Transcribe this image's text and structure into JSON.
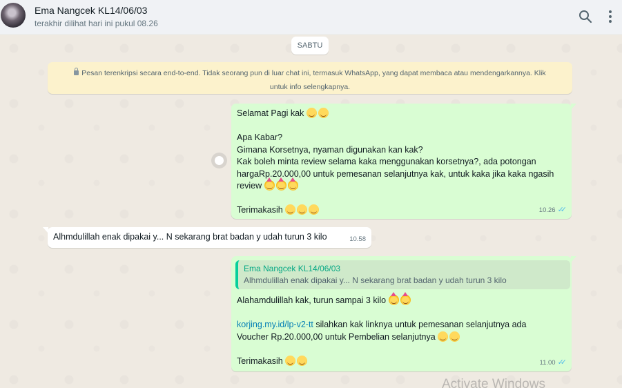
{
  "header": {
    "contact_name": "Ema Nangcek KL14/06/03",
    "last_seen": "terakhir dilihat hari ini pukul 08.26",
    "search_icon": "search-icon",
    "menu_icon": "more-vertical-icon"
  },
  "chat": {
    "date_chip": "SABTU",
    "encryption_notice_line1": "Pesan terenkripsi secara end-to-end. Tidak seorang pun di luar chat ini, termasuk WhatsApp, yang dapat membaca atau mendengarkannya. Klik",
    "encryption_notice_line2": "untuk info selengkapnya.",
    "messages": [
      {
        "direction": "outgoing",
        "line1": "Selamat Pagi kak",
        "line2": "Apa Kabar?",
        "line3": "Gimana Korsetnya, nyaman digunakan kan kak?",
        "line4": "Kak boleh minta review selama kaka menggunakan korsetnya?, ada potongan",
        "line5": "hargaRp.20.000,00 untuk pemesanan selanjutnya kak, untuk kaka jika kaka ngasih",
        "line6": "review",
        "line7": "Terimakasih",
        "time": "10.26",
        "status": "read"
      },
      {
        "direction": "incoming",
        "text": "Alhmdulillah enak dipakai y... N sekarang brat badan y udah turun 3 kilo",
        "time": "10.58"
      },
      {
        "direction": "outgoing",
        "quote_author": "Ema Nangcek KL14/06/03",
        "quote_text": "Alhmdulillah enak dipakai y... N sekarang brat badan y udah turun 3 kilo",
        "line1": "Alahamdulillah kak, turun sampai 3 kilo",
        "link": "korjing.my.id/lp-v2-tt",
        "line2_rest": " silahkan kak linknya untuk pemesanan selanjutnya ada",
        "line3": "Voucher Rp.20.000,00 untuk Pembelian selanjutnya",
        "line4": "Terimakasih",
        "time": "11.00",
        "status": "read"
      }
    ]
  },
  "watermark": "Activate Windows",
  "colors": {
    "outgoing_bubble": "#d9fdd3",
    "incoming_bubble": "#ffffff",
    "read_ticks": "#53bdeb",
    "link": "#027eb5",
    "notice_bg": "#fcf2cc"
  }
}
